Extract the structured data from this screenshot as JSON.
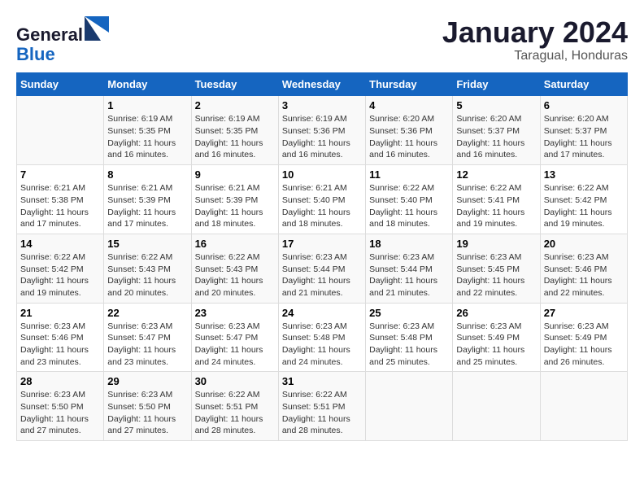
{
  "header": {
    "logo_line1": "General",
    "logo_line2": "Blue",
    "month_title": "January 2024",
    "location": "Taragual, Honduras"
  },
  "days_of_week": [
    "Sunday",
    "Monday",
    "Tuesday",
    "Wednesday",
    "Thursday",
    "Friday",
    "Saturday"
  ],
  "weeks": [
    [
      {
        "day": "",
        "sunrise": "",
        "sunset": "",
        "daylight": ""
      },
      {
        "day": "1",
        "sunrise": "Sunrise: 6:19 AM",
        "sunset": "Sunset: 5:35 PM",
        "daylight": "Daylight: 11 hours and 16 minutes."
      },
      {
        "day": "2",
        "sunrise": "Sunrise: 6:19 AM",
        "sunset": "Sunset: 5:35 PM",
        "daylight": "Daylight: 11 hours and 16 minutes."
      },
      {
        "day": "3",
        "sunrise": "Sunrise: 6:19 AM",
        "sunset": "Sunset: 5:36 PM",
        "daylight": "Daylight: 11 hours and 16 minutes."
      },
      {
        "day": "4",
        "sunrise": "Sunrise: 6:20 AM",
        "sunset": "Sunset: 5:36 PM",
        "daylight": "Daylight: 11 hours and 16 minutes."
      },
      {
        "day": "5",
        "sunrise": "Sunrise: 6:20 AM",
        "sunset": "Sunset: 5:37 PM",
        "daylight": "Daylight: 11 hours and 16 minutes."
      },
      {
        "day": "6",
        "sunrise": "Sunrise: 6:20 AM",
        "sunset": "Sunset: 5:37 PM",
        "daylight": "Daylight: 11 hours and 17 minutes."
      }
    ],
    [
      {
        "day": "7",
        "sunrise": "Sunrise: 6:21 AM",
        "sunset": "Sunset: 5:38 PM",
        "daylight": "Daylight: 11 hours and 17 minutes."
      },
      {
        "day": "8",
        "sunrise": "Sunrise: 6:21 AM",
        "sunset": "Sunset: 5:39 PM",
        "daylight": "Daylight: 11 hours and 17 minutes."
      },
      {
        "day": "9",
        "sunrise": "Sunrise: 6:21 AM",
        "sunset": "Sunset: 5:39 PM",
        "daylight": "Daylight: 11 hours and 18 minutes."
      },
      {
        "day": "10",
        "sunrise": "Sunrise: 6:21 AM",
        "sunset": "Sunset: 5:40 PM",
        "daylight": "Daylight: 11 hours and 18 minutes."
      },
      {
        "day": "11",
        "sunrise": "Sunrise: 6:22 AM",
        "sunset": "Sunset: 5:40 PM",
        "daylight": "Daylight: 11 hours and 18 minutes."
      },
      {
        "day": "12",
        "sunrise": "Sunrise: 6:22 AM",
        "sunset": "Sunset: 5:41 PM",
        "daylight": "Daylight: 11 hours and 19 minutes."
      },
      {
        "day": "13",
        "sunrise": "Sunrise: 6:22 AM",
        "sunset": "Sunset: 5:42 PM",
        "daylight": "Daylight: 11 hours and 19 minutes."
      }
    ],
    [
      {
        "day": "14",
        "sunrise": "Sunrise: 6:22 AM",
        "sunset": "Sunset: 5:42 PM",
        "daylight": "Daylight: 11 hours and 19 minutes."
      },
      {
        "day": "15",
        "sunrise": "Sunrise: 6:22 AM",
        "sunset": "Sunset: 5:43 PM",
        "daylight": "Daylight: 11 hours and 20 minutes."
      },
      {
        "day": "16",
        "sunrise": "Sunrise: 6:22 AM",
        "sunset": "Sunset: 5:43 PM",
        "daylight": "Daylight: 11 hours and 20 minutes."
      },
      {
        "day": "17",
        "sunrise": "Sunrise: 6:23 AM",
        "sunset": "Sunset: 5:44 PM",
        "daylight": "Daylight: 11 hours and 21 minutes."
      },
      {
        "day": "18",
        "sunrise": "Sunrise: 6:23 AM",
        "sunset": "Sunset: 5:44 PM",
        "daylight": "Daylight: 11 hours and 21 minutes."
      },
      {
        "day": "19",
        "sunrise": "Sunrise: 6:23 AM",
        "sunset": "Sunset: 5:45 PM",
        "daylight": "Daylight: 11 hours and 22 minutes."
      },
      {
        "day": "20",
        "sunrise": "Sunrise: 6:23 AM",
        "sunset": "Sunset: 5:46 PM",
        "daylight": "Daylight: 11 hours and 22 minutes."
      }
    ],
    [
      {
        "day": "21",
        "sunrise": "Sunrise: 6:23 AM",
        "sunset": "Sunset: 5:46 PM",
        "daylight": "Daylight: 11 hours and 23 minutes."
      },
      {
        "day": "22",
        "sunrise": "Sunrise: 6:23 AM",
        "sunset": "Sunset: 5:47 PM",
        "daylight": "Daylight: 11 hours and 23 minutes."
      },
      {
        "day": "23",
        "sunrise": "Sunrise: 6:23 AM",
        "sunset": "Sunset: 5:47 PM",
        "daylight": "Daylight: 11 hours and 24 minutes."
      },
      {
        "day": "24",
        "sunrise": "Sunrise: 6:23 AM",
        "sunset": "Sunset: 5:48 PM",
        "daylight": "Daylight: 11 hours and 24 minutes."
      },
      {
        "day": "25",
        "sunrise": "Sunrise: 6:23 AM",
        "sunset": "Sunset: 5:48 PM",
        "daylight": "Daylight: 11 hours and 25 minutes."
      },
      {
        "day": "26",
        "sunrise": "Sunrise: 6:23 AM",
        "sunset": "Sunset: 5:49 PM",
        "daylight": "Daylight: 11 hours and 25 minutes."
      },
      {
        "day": "27",
        "sunrise": "Sunrise: 6:23 AM",
        "sunset": "Sunset: 5:49 PM",
        "daylight": "Daylight: 11 hours and 26 minutes."
      }
    ],
    [
      {
        "day": "28",
        "sunrise": "Sunrise: 6:23 AM",
        "sunset": "Sunset: 5:50 PM",
        "daylight": "Daylight: 11 hours and 27 minutes."
      },
      {
        "day": "29",
        "sunrise": "Sunrise: 6:23 AM",
        "sunset": "Sunset: 5:50 PM",
        "daylight": "Daylight: 11 hours and 27 minutes."
      },
      {
        "day": "30",
        "sunrise": "Sunrise: 6:22 AM",
        "sunset": "Sunset: 5:51 PM",
        "daylight": "Daylight: 11 hours and 28 minutes."
      },
      {
        "day": "31",
        "sunrise": "Sunrise: 6:22 AM",
        "sunset": "Sunset: 5:51 PM",
        "daylight": "Daylight: 11 hours and 28 minutes."
      },
      {
        "day": "",
        "sunrise": "",
        "sunset": "",
        "daylight": ""
      },
      {
        "day": "",
        "sunrise": "",
        "sunset": "",
        "daylight": ""
      },
      {
        "day": "",
        "sunrise": "",
        "sunset": "",
        "daylight": ""
      }
    ]
  ]
}
